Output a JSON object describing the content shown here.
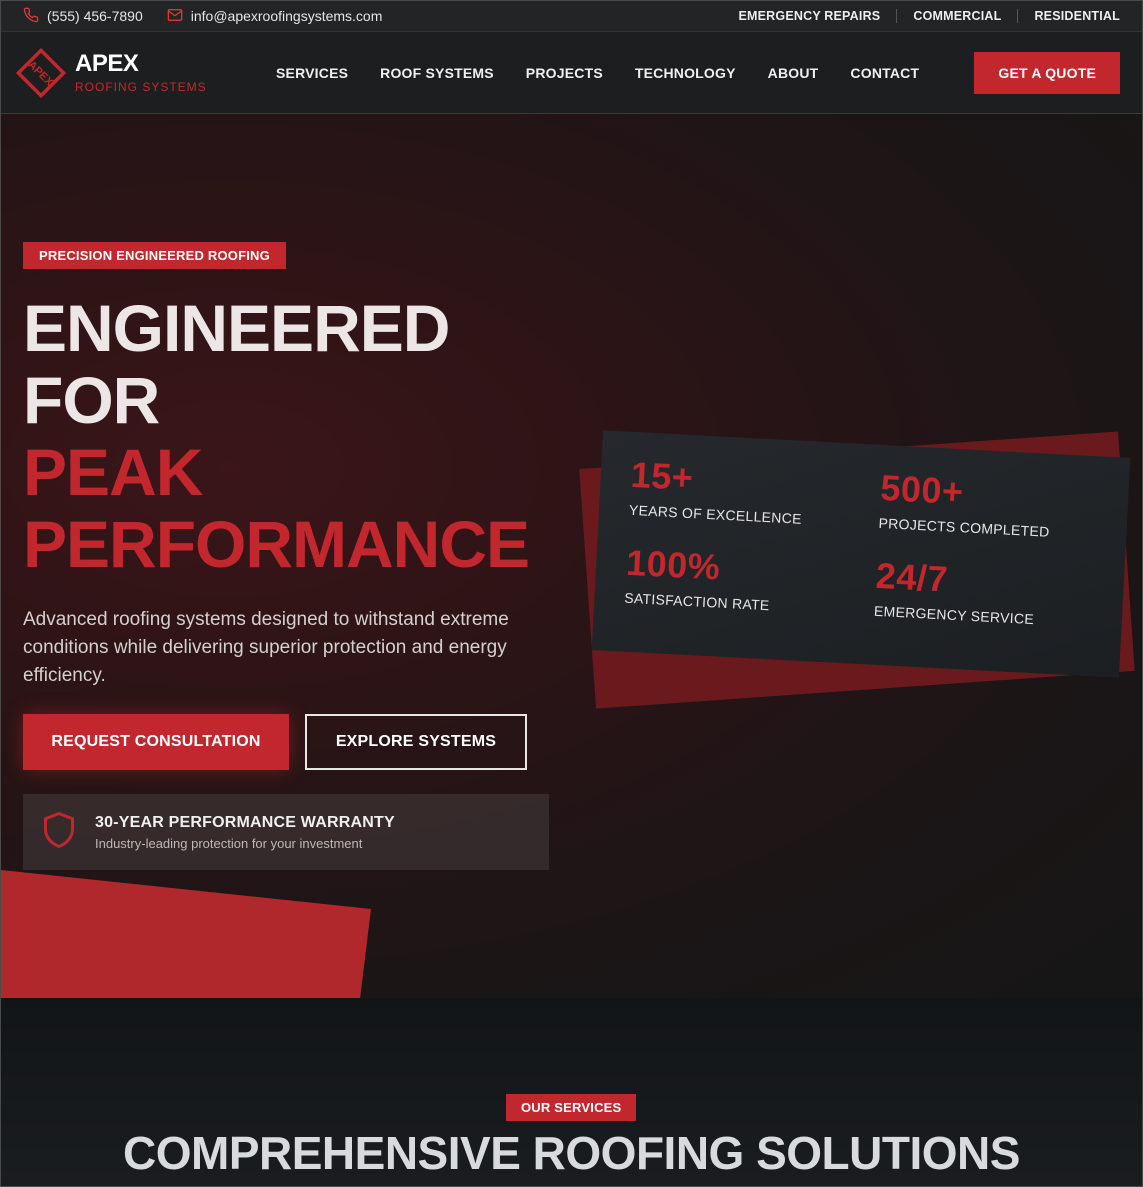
{
  "topbar": {
    "phone": "(555) 456-7890",
    "email": "info@apexroofingsystems.com",
    "links": [
      "EMERGENCY REPAIRS",
      "COMMERCIAL",
      "RESIDENTIAL"
    ]
  },
  "brand": {
    "name": "APEX",
    "tagline": "ROOFING SYSTEMS",
    "mark_text": "APEX",
    "accent": "#c1272d"
  },
  "nav": {
    "items": [
      "SERVICES",
      "ROOF SYSTEMS",
      "PROJECTS",
      "TECHNOLOGY",
      "ABOUT",
      "CONTACT"
    ],
    "cta": "GET A QUOTE"
  },
  "hero": {
    "badge": "PRECISION ENGINEERED ROOFING",
    "title_line1": "ENGINEERED",
    "title_line2": "FOR",
    "title_line3": "PEAK",
    "title_line4": "PERFORMANCE",
    "description": "Advanced roofing systems designed to withstand extreme conditions while delivering superior protection and energy efficiency.",
    "primary_button": "REQUEST CONSULTATION",
    "secondary_button": "EXPLORE SYSTEMS",
    "warranty_title": "30-YEAR PERFORMANCE WARRANTY",
    "warranty_sub": "Industry-leading protection for your investment"
  },
  "stats": [
    {
      "value": "15+",
      "label": "YEARS OF EXCELLENCE"
    },
    {
      "value": "500+",
      "label": "PROJECTS COMPLETED"
    },
    {
      "value": "100%",
      "label": "SATISFACTION RATE"
    },
    {
      "value": "24/7",
      "label": "EMERGENCY SERVICE"
    }
  ],
  "services": {
    "badge": "OUR SERVICES",
    "title": "COMPREHENSIVE ROOFING SOLUTIONS"
  }
}
